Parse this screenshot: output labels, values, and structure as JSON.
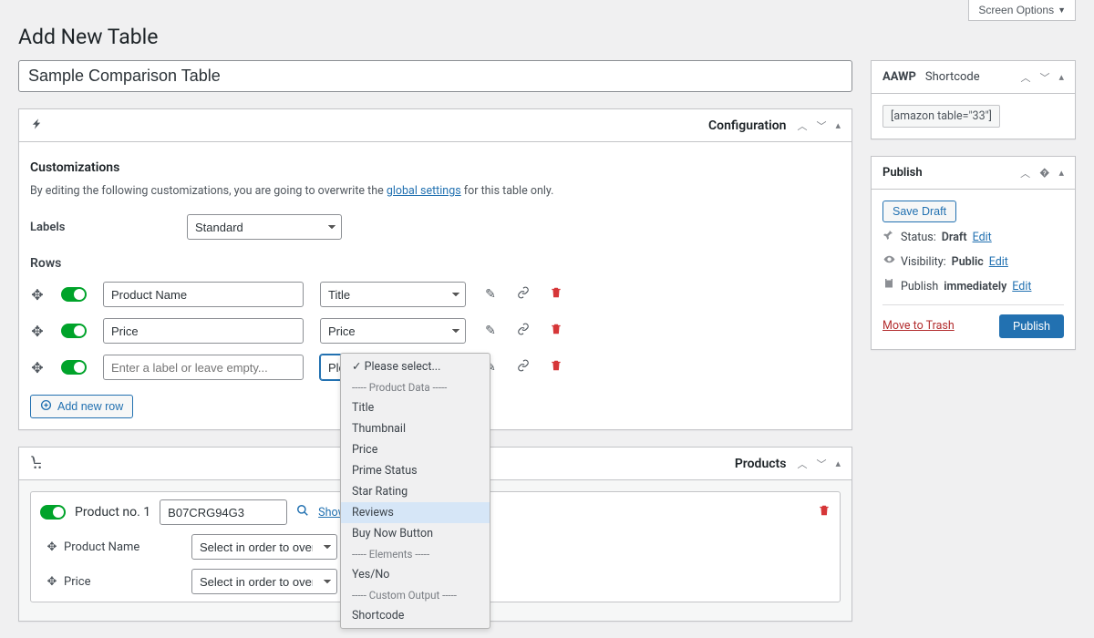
{
  "screen_options_label": "Screen Options",
  "page_title": "Add New Table",
  "title_input_value": "Sample Comparison Table",
  "configuration": {
    "box_title": "Configuration",
    "customizations_heading": "Customizations",
    "help_pre": "By editing the following customizations, you are going to overwrite the ",
    "help_link": "global settings",
    "help_post": " for this table only.",
    "labels_label": "Labels",
    "labels_value": "Standard",
    "rows_heading": "Rows",
    "add_row_label": "Add new row",
    "rows": [
      {
        "label": "Product Name",
        "type": "Title"
      },
      {
        "label": "Price",
        "type": "Price"
      },
      {
        "label_placeholder": "Enter a label or leave empty...",
        "type": "Please select..."
      }
    ]
  },
  "dropdown": {
    "selected": "Please select...",
    "group1_label": "----- Product Data -----",
    "items1": [
      "Title",
      "Thumbnail",
      "Price",
      "Prime Status",
      "Star Rating",
      "Reviews",
      "Buy Now Button"
    ],
    "group2_label": "----- Elements -----",
    "items2": [
      "Yes/No"
    ],
    "group3_label": "----- Custom Output -----",
    "items3": [
      "Shortcode"
    ]
  },
  "products": {
    "box_title": "Products",
    "item_title": "Product no. 1",
    "asin_value": "B07CRG94G3",
    "show_link": "Show",
    "detail_rows": [
      {
        "label": "Product Name",
        "value": "Select in order to overwrite..."
      },
      {
        "label": "Price",
        "value": "Select in order to overwrite..."
      }
    ]
  },
  "aawp": {
    "tab_aawp": "AAWP",
    "tab_shortcode": "Shortcode",
    "shortcode_value": "[amazon table=\"33\"]"
  },
  "publish": {
    "box_title": "Publish",
    "save_draft": "Save Draft",
    "status_label": "Status:",
    "status_value": "Draft",
    "visibility_label": "Visibility:",
    "visibility_value": "Public",
    "publish_label_pre": "Publish",
    "publish_label_bold": "immediately",
    "edit_link": "Edit",
    "move_trash": "Move to Trash",
    "publish_btn": "Publish"
  }
}
